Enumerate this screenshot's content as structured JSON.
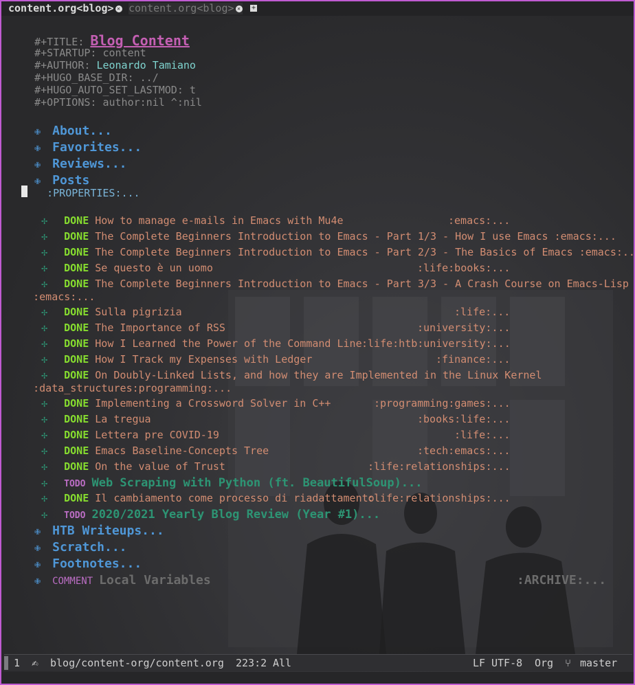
{
  "tabs": [
    {
      "label": "content.org<blog>",
      "active": true
    },
    {
      "label": "content.org<blog>",
      "active": false
    }
  ],
  "header": {
    "title_kw": "#+TITLE:",
    "title": "Blog Content",
    "startup_kw": "#+STARTUP:",
    "startup": "content",
    "author_kw": "#+AUTHOR:",
    "author": "Leonardo Tamiano",
    "hugo_base_kw": "#+HUGO_BASE_DIR:",
    "hugo_base": "../",
    "hugo_auto_kw": "#+HUGO_AUTO_SET_LASTMOD:",
    "hugo_auto": "t",
    "options_kw": "#+OPTIONS:",
    "options": "author:nil ^:nil"
  },
  "headings": {
    "about": "About...",
    "favorites": "Favorites...",
    "reviews": "Reviews...",
    "posts": "Posts",
    "properties": ":PROPERTIES:...",
    "htb": "HTB Writeups...",
    "scratch": "Scratch...",
    "footnotes": "Footnotes...",
    "comment_kw": "COMMENT",
    "local_vars": "Local Variables",
    "archive_tag": ":ARCHIVE:..."
  },
  "entries": [
    {
      "state": "DONE",
      "text": "How to manage e-mails in Emacs with Mu4e",
      "tags": ":emacs:..."
    },
    {
      "state": "DONE",
      "text": "The Complete Beginners Introduction to Emacs - Part 1/3 - How I use Emacs",
      "tags": ":emacs:..."
    },
    {
      "state": "DONE",
      "text": "The Complete Beginners Introduction to Emacs - Part 2/3 - The Basics of Emacs",
      "tags": ":emacs:..."
    },
    {
      "state": "DONE",
      "text": "Se questo è un uomo",
      "tags": ":life:books:..."
    },
    {
      "state": "DONE",
      "text": "The Complete Beginners Introduction to Emacs - Part 3/3 - A Crash Course on Emacs-Lisp",
      "tags": ":emacs:..."
    },
    {
      "state": "DONE",
      "text": "Sulla pigrizia",
      "tags": ":life:..."
    },
    {
      "state": "DONE",
      "text": "The Importance of RSS",
      "tags": ":university:..."
    },
    {
      "state": "DONE",
      "text": "How I Learned the Power of the Command Line",
      "tags": ":life:htb:university:..."
    },
    {
      "state": "DONE",
      "text": "How I Track my Expenses with Ledger",
      "tags": ":finance:..."
    },
    {
      "state": "DONE",
      "text": "On Doubly-Linked Lists, and how they are Implemented in the Linux Kernel",
      "tags": ":data_structures:programming:..."
    },
    {
      "state": "DONE",
      "text": "Implementing a Crossword Solver in C++",
      "tags": ":programming:games:..."
    },
    {
      "state": "DONE",
      "text": "La tregua",
      "tags": ":books:life:..."
    },
    {
      "state": "DONE",
      "text": "Lettera pre COVID-19",
      "tags": ":life:..."
    },
    {
      "state": "DONE",
      "text": "Emacs Baseline-Concepts Tree",
      "tags": ":tech:emacs:..."
    },
    {
      "state": "DONE",
      "text": "On the value of Trust",
      "tags": ":life:relationships:..."
    },
    {
      "state": "TODO",
      "text": "Web Scraping with Python (ft. BeautifulSoup)..."
    },
    {
      "state": "DONE",
      "text": "Il cambiamento come processo di riadattamento",
      "tags": ":life:relationships:..."
    },
    {
      "state": "TODO",
      "text": "2020/2021 Yearly Blog Review (Year #1)..."
    }
  ],
  "modeline": {
    "window_number": "1",
    "file_path": "blog/content-org/content.org",
    "position": "223:2",
    "scroll": "All",
    "eol": "LF",
    "encoding": "UTF-8",
    "major_mode": "Org",
    "branch": "master"
  },
  "colors": {
    "frame_border": "#c05bd2",
    "done": "#86dc2f",
    "todo": "#bc6ec5",
    "heading": "#4f97d7",
    "entry": "#d38d72"
  }
}
